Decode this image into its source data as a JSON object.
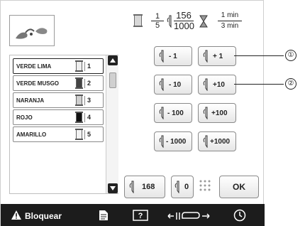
{
  "status": {
    "stitch_frac": {
      "num": "1",
      "den": "5"
    },
    "stitch_count": {
      "num": "156",
      "den": "1000"
    },
    "time": {
      "num": "1 min",
      "den": "3 min"
    }
  },
  "colors": [
    {
      "name": "VERDE LIMA",
      "number": "1",
      "selected": true,
      "swatch": "#eeeeee"
    },
    {
      "name": "VERDE MUSGO",
      "number": "2",
      "selected": false,
      "swatch": "#444444"
    },
    {
      "name": "NARANJA",
      "number": "3",
      "selected": false,
      "swatch": "#cfcfcf"
    },
    {
      "name": "ROJO",
      "number": "4",
      "selected": false,
      "swatch": "#111111"
    },
    {
      "name": "AMARILLO",
      "number": "5",
      "selected": false,
      "swatch": "#f2f2f2"
    }
  ],
  "adjust_buttons": [
    {
      "minus": "- 1",
      "plus": "+ 1"
    },
    {
      "minus": "- 10",
      "plus": "+10"
    },
    {
      "minus": "- 100",
      "plus": "+100"
    },
    {
      "minus": "- 1000",
      "plus": "+1000"
    }
  ],
  "bottom_controls": {
    "stitch_value": "168",
    "zero_value": "0",
    "ok_label": "OK"
  },
  "bottom_bar": {
    "lock_label": "Bloquear",
    "icons": [
      "warning-icon",
      "document-icon",
      "help-icon",
      "thread-tension-icon",
      "clock-icon"
    ]
  },
  "callouts": {
    "first": "①",
    "second": "②"
  }
}
